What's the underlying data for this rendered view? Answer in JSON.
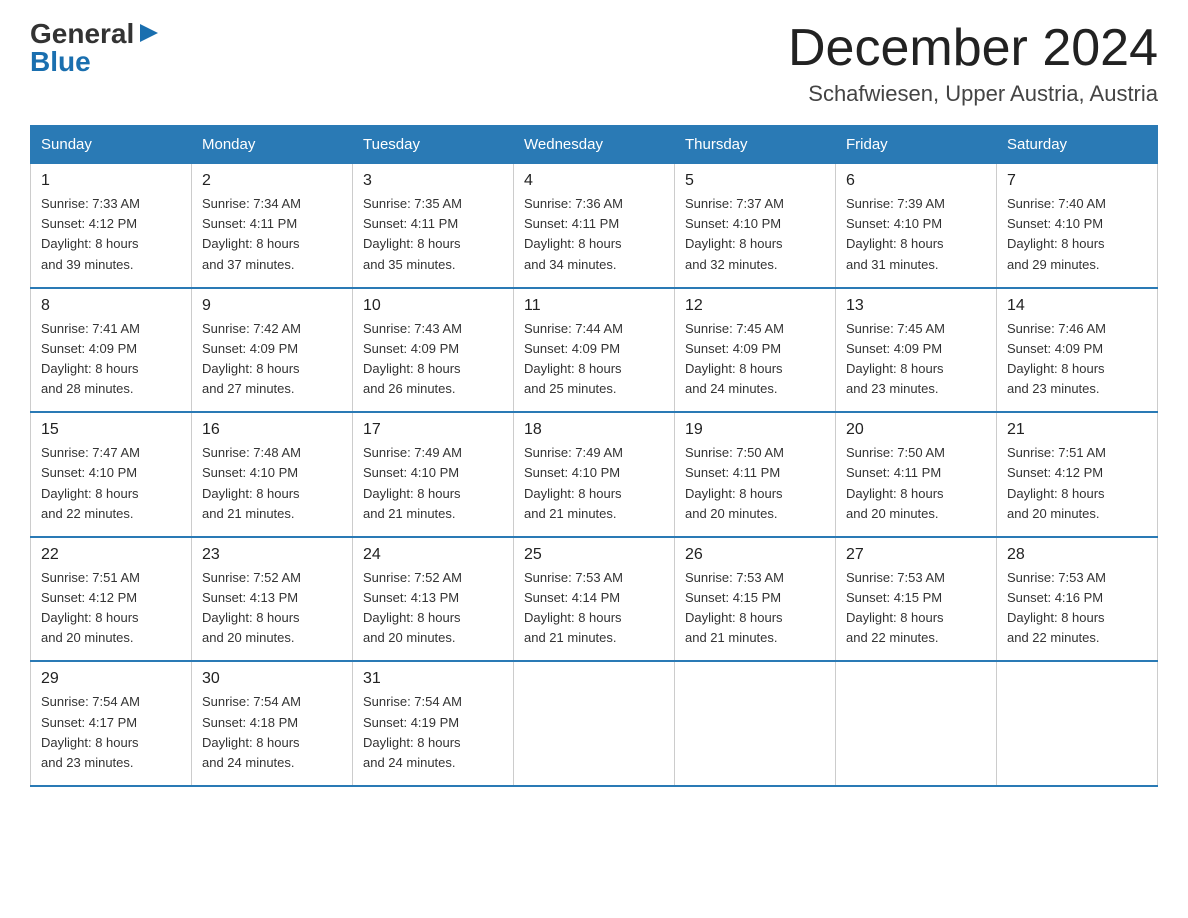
{
  "header": {
    "logo_line1": "General",
    "logo_line2": "Blue",
    "month_title": "December 2024",
    "location": "Schafwiesen, Upper Austria, Austria"
  },
  "days_of_week": [
    "Sunday",
    "Monday",
    "Tuesday",
    "Wednesday",
    "Thursday",
    "Friday",
    "Saturday"
  ],
  "weeks": [
    [
      {
        "day": "1",
        "sunrise": "7:33 AM",
        "sunset": "4:12 PM",
        "daylight": "8 hours and 39 minutes."
      },
      {
        "day": "2",
        "sunrise": "7:34 AM",
        "sunset": "4:11 PM",
        "daylight": "8 hours and 37 minutes."
      },
      {
        "day": "3",
        "sunrise": "7:35 AM",
        "sunset": "4:11 PM",
        "daylight": "8 hours and 35 minutes."
      },
      {
        "day": "4",
        "sunrise": "7:36 AM",
        "sunset": "4:11 PM",
        "daylight": "8 hours and 34 minutes."
      },
      {
        "day": "5",
        "sunrise": "7:37 AM",
        "sunset": "4:10 PM",
        "daylight": "8 hours and 32 minutes."
      },
      {
        "day": "6",
        "sunrise": "7:39 AM",
        "sunset": "4:10 PM",
        "daylight": "8 hours and 31 minutes."
      },
      {
        "day": "7",
        "sunrise": "7:40 AM",
        "sunset": "4:10 PM",
        "daylight": "8 hours and 29 minutes."
      }
    ],
    [
      {
        "day": "8",
        "sunrise": "7:41 AM",
        "sunset": "4:09 PM",
        "daylight": "8 hours and 28 minutes."
      },
      {
        "day": "9",
        "sunrise": "7:42 AM",
        "sunset": "4:09 PM",
        "daylight": "8 hours and 27 minutes."
      },
      {
        "day": "10",
        "sunrise": "7:43 AM",
        "sunset": "4:09 PM",
        "daylight": "8 hours and 26 minutes."
      },
      {
        "day": "11",
        "sunrise": "7:44 AM",
        "sunset": "4:09 PM",
        "daylight": "8 hours and 25 minutes."
      },
      {
        "day": "12",
        "sunrise": "7:45 AM",
        "sunset": "4:09 PM",
        "daylight": "8 hours and 24 minutes."
      },
      {
        "day": "13",
        "sunrise": "7:45 AM",
        "sunset": "4:09 PM",
        "daylight": "8 hours and 23 minutes."
      },
      {
        "day": "14",
        "sunrise": "7:46 AM",
        "sunset": "4:09 PM",
        "daylight": "8 hours and 23 minutes."
      }
    ],
    [
      {
        "day": "15",
        "sunrise": "7:47 AM",
        "sunset": "4:10 PM",
        "daylight": "8 hours and 22 minutes."
      },
      {
        "day": "16",
        "sunrise": "7:48 AM",
        "sunset": "4:10 PM",
        "daylight": "8 hours and 21 minutes."
      },
      {
        "day": "17",
        "sunrise": "7:49 AM",
        "sunset": "4:10 PM",
        "daylight": "8 hours and 21 minutes."
      },
      {
        "day": "18",
        "sunrise": "7:49 AM",
        "sunset": "4:10 PM",
        "daylight": "8 hours and 21 minutes."
      },
      {
        "day": "19",
        "sunrise": "7:50 AM",
        "sunset": "4:11 PM",
        "daylight": "8 hours and 20 minutes."
      },
      {
        "day": "20",
        "sunrise": "7:50 AM",
        "sunset": "4:11 PM",
        "daylight": "8 hours and 20 minutes."
      },
      {
        "day": "21",
        "sunrise": "7:51 AM",
        "sunset": "4:12 PM",
        "daylight": "8 hours and 20 minutes."
      }
    ],
    [
      {
        "day": "22",
        "sunrise": "7:51 AM",
        "sunset": "4:12 PM",
        "daylight": "8 hours and 20 minutes."
      },
      {
        "day": "23",
        "sunrise": "7:52 AM",
        "sunset": "4:13 PM",
        "daylight": "8 hours and 20 minutes."
      },
      {
        "day": "24",
        "sunrise": "7:52 AM",
        "sunset": "4:13 PM",
        "daylight": "8 hours and 20 minutes."
      },
      {
        "day": "25",
        "sunrise": "7:53 AM",
        "sunset": "4:14 PM",
        "daylight": "8 hours and 21 minutes."
      },
      {
        "day": "26",
        "sunrise": "7:53 AM",
        "sunset": "4:15 PM",
        "daylight": "8 hours and 21 minutes."
      },
      {
        "day": "27",
        "sunrise": "7:53 AM",
        "sunset": "4:15 PM",
        "daylight": "8 hours and 22 minutes."
      },
      {
        "day": "28",
        "sunrise": "7:53 AM",
        "sunset": "4:16 PM",
        "daylight": "8 hours and 22 minutes."
      }
    ],
    [
      {
        "day": "29",
        "sunrise": "7:54 AM",
        "sunset": "4:17 PM",
        "daylight": "8 hours and 23 minutes."
      },
      {
        "day": "30",
        "sunrise": "7:54 AM",
        "sunset": "4:18 PM",
        "daylight": "8 hours and 24 minutes."
      },
      {
        "day": "31",
        "sunrise": "7:54 AM",
        "sunset": "4:19 PM",
        "daylight": "8 hours and 24 minutes."
      },
      null,
      null,
      null,
      null
    ]
  ],
  "labels": {
    "sunrise": "Sunrise:",
    "sunset": "Sunset:",
    "daylight": "Daylight:"
  }
}
